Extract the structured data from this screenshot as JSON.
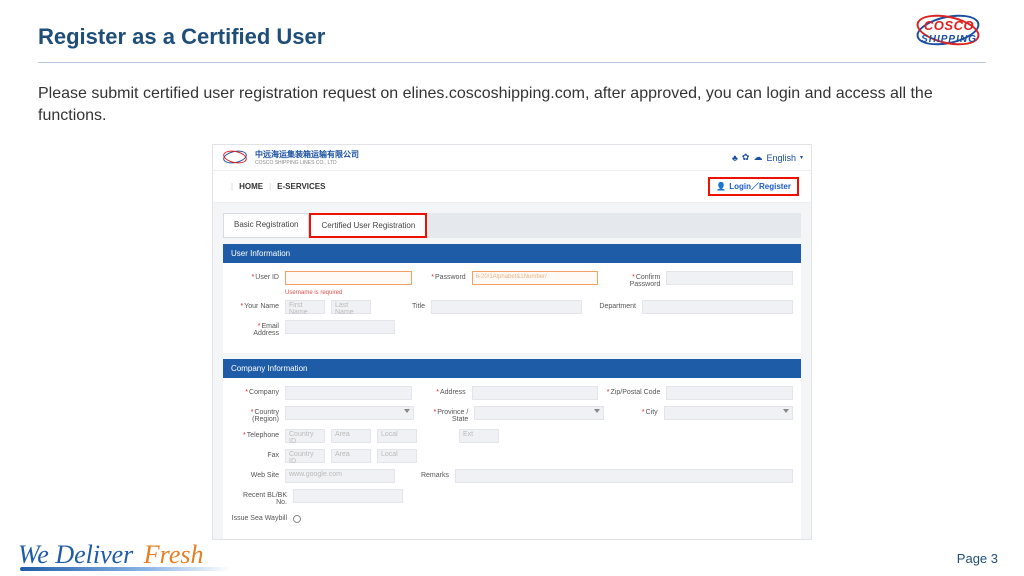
{
  "header": {
    "title": "Register as a Certified User",
    "logo": {
      "line1": "COSCO",
      "line2": "SHIPPING"
    }
  },
  "intro_text": "Please submit certified user registration request on elines.coscoshipping.com,  after approved, you can login and access all the functions.",
  "inner": {
    "top": {
      "company_cn": "中远海运集装箱运输有限公司",
      "company_en": "COSCO SHIPPING LINES CO., LTD",
      "lang_label": "English"
    },
    "nav": {
      "home": "HOME",
      "eservices": "E-SERVICES",
      "login": "Login／Register"
    },
    "tabs": {
      "basic": "Basic Registration",
      "certified": "Certified User Registration"
    },
    "sections": {
      "user_info": "User Information",
      "company_info": "Company Information"
    },
    "labels": {
      "user_id": "User ID",
      "password": "Password",
      "password_hint": "6-20/1Alphabet&1Number/",
      "confirm_pw": "Confirm Password",
      "username_err": "Username is required",
      "your_name": "Your Name",
      "first_name": "First Name",
      "last_name": "Last Name",
      "title": "Title",
      "department": "Department",
      "email": "Email Address",
      "company": "Company",
      "address": "Address",
      "zip": "Zip/Postal Code",
      "country": "Country (Region)",
      "province": "Province / State",
      "city": "City",
      "telephone": "Telephone",
      "country_id": "Country ID",
      "area": "Area",
      "local": "Local",
      "ext": "Ext",
      "fax": "Fax",
      "website": "Web Site",
      "website_hint": "www.google.com",
      "remarks": "Remarks",
      "recent_bl": "Recent BL/BK No.",
      "issue_swb": "Issue Sea Waybill"
    }
  },
  "footer": {
    "tagline_w1": "We",
    "tagline_w2": "Deliver",
    "tagline_w3": "Fresh",
    "page_label": "Page 3"
  }
}
